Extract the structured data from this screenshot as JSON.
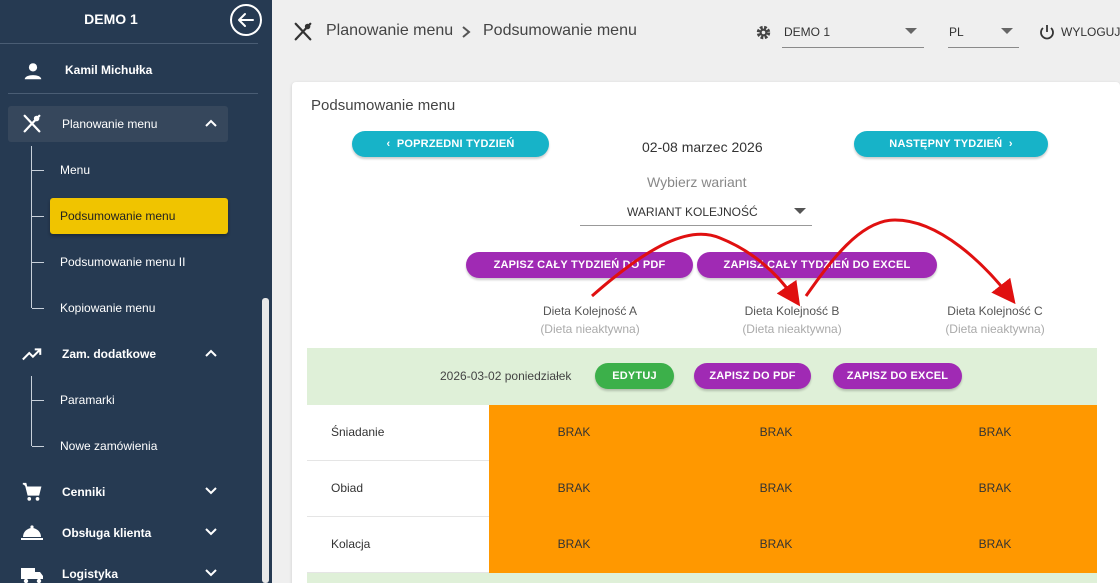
{
  "sidebar": {
    "title": "DEMO 1",
    "user_name": "Kamil Michułka",
    "items": [
      {
        "label": "Planowanie menu",
        "icon": "cutlery-icon"
      },
      {
        "label": "Zam. dodatkowe",
        "icon": "trending-up-icon"
      },
      {
        "label": "Cenniki",
        "icon": "cart-icon"
      },
      {
        "label": "Obsługa klienta",
        "icon": "cloche-icon"
      },
      {
        "label": "Logistyka",
        "icon": "truck-icon"
      }
    ],
    "planowanie_sub": [
      "Menu",
      "Podsumowanie menu",
      "Podsumowanie menu II",
      "Kopiowanie menu"
    ],
    "zam_sub": [
      "Paramarki",
      "Nowe zamówienia"
    ]
  },
  "header": {
    "breadcrumb_1": "Planowanie menu",
    "breadcrumb_2": "Podsumowanie menu",
    "org_select": "DEMO 1",
    "lang_select": "PL",
    "logout": "WYLOGUJ"
  },
  "main": {
    "title": "Podsumowanie menu",
    "prev_week": "POPRZEDNI TYDZIEŃ",
    "next_week": "NASTĘPNY TYDZIEŃ",
    "week_range": "02-08 marzec 2026",
    "variant_label": "Wybierz wariant",
    "variant_value": "WARIANT KOLEJNOŚĆ",
    "save_week_pdf": "ZAPISZ CAŁY TYDZIEŃ DO PDF",
    "save_week_excel": "ZAPISZ CAŁY TYDZIEŃ DO EXCEL",
    "diets": [
      {
        "name": "Dieta Kolejność A",
        "status": "(Dieta nieaktywna)"
      },
      {
        "name": "Dieta Kolejność B",
        "status": "(Dieta nieaktywna)"
      },
      {
        "name": "Dieta Kolejność C",
        "status": "(Dieta nieaktywna)"
      }
    ],
    "day": {
      "date": "2026-03-02 poniedziałek",
      "edit": "EDYTUJ",
      "save_pdf": "ZAPISZ DO PDF",
      "save_excel": "ZAPISZ DO EXCEL"
    },
    "meals": [
      {
        "name": "Śniadanie",
        "cells": [
          "BRAK",
          "BRAK",
          "BRAK"
        ]
      },
      {
        "name": "Obiad",
        "cells": [
          "BRAK",
          "BRAK",
          "BRAK"
        ]
      },
      {
        "name": "Kolacja",
        "cells": [
          "BRAK",
          "BRAK",
          "BRAK"
        ]
      }
    ]
  },
  "colors": {
    "sidebar": "#263a52",
    "selected": "#f0c400",
    "cyan": "#17b3c8",
    "purple": "#a02ab4",
    "green": "#3cb04a",
    "orange": "#ff9800",
    "annotation_arrow": "#e01010"
  }
}
